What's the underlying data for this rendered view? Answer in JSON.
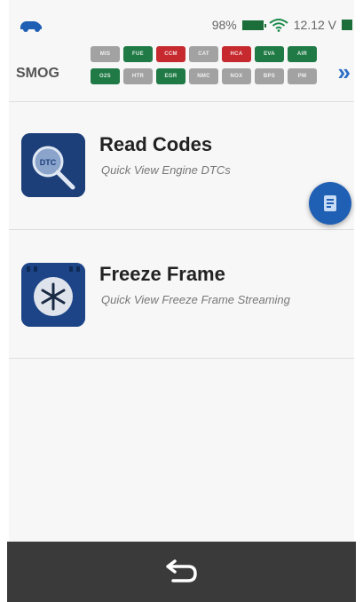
{
  "status_bar": {
    "battery_text": "98%",
    "voltage_text": "12.12 V",
    "icons": [
      "car-icon",
      "battery-icon",
      "wifi-icon",
      "voltage-indicator-icon"
    ]
  },
  "smog": {
    "label": "SMOG",
    "monitors": [
      {
        "label": "MIS",
        "status": "gray"
      },
      {
        "label": "FUE",
        "status": "green"
      },
      {
        "label": "CCM",
        "status": "red"
      },
      {
        "label": "CAT",
        "status": "gray"
      },
      {
        "label": "HCA",
        "status": "red"
      },
      {
        "label": "EVA",
        "status": "green"
      },
      {
        "label": "AIR",
        "status": "green"
      },
      {
        "label": "O2S",
        "status": "green"
      },
      {
        "label": "HTR",
        "status": "gray"
      },
      {
        "label": "EGR",
        "status": "green"
      },
      {
        "label": "NMC",
        "status": "gray"
      },
      {
        "label": "NOX",
        "status": "gray"
      },
      {
        "label": "BPS",
        "status": "gray"
      },
      {
        "label": "PM",
        "status": "gray"
      }
    ],
    "next_icon": "double-chevron-right-icon"
  },
  "menu": [
    {
      "title": "Read Codes",
      "subtitle": "Quick View Engine DTCs",
      "icon": "dtc-magnifier-icon"
    },
    {
      "title": "Freeze Frame",
      "subtitle": "Quick View Freeze Frame Streaming",
      "icon": "snowflake-icon"
    }
  ],
  "fab": {
    "icon": "print-report-icon"
  },
  "bottom_nav": {
    "back_icon": "back-arrow-icon"
  },
  "colors": {
    "ok_green": "#1f7a45",
    "fail_red": "#c62a2e",
    "na_gray": "#a2a2a2",
    "accent_blue": "#2b6fc4",
    "nav_bg": "#3a3a3a"
  }
}
